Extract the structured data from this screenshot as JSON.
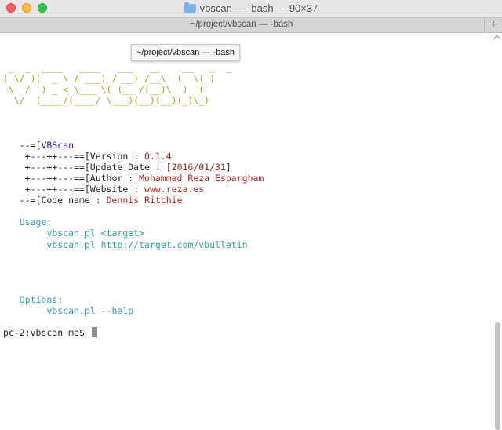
{
  "window": {
    "title": "vbscan — -bash — 90×37"
  },
  "tab": {
    "label": "~/project/vbscan — -bash",
    "add": "+"
  },
  "tooltip": "~/project/vbscan — -bash",
  "banner": [
    " _  _  ____   ____   ___   __    __   _  _ ",
    "( \\/ )(  _ \\ / ___) / __) /__\\  (  \\( )",
    " \\  /  ) _ < \\___ \\( (__ /(__)\\  )  (",
    "  \\/  (____/(____/ \\___)(__)(__)(_)\\_)"
  ],
  "info": {
    "vbscan_prefix": "   --=[",
    "vbscan_name": "VBScan",
    "version_prefix": "    +---++---==[Version : ",
    "version_value": "0.1.4",
    "update_prefix": "    +---++---==[Update Date : [",
    "update_value": "2016/01/31",
    "update_suffix": "]",
    "author_prefix": "    +---++---==[Author : ",
    "author_value": "Mohammad Reza Espargham",
    "website_prefix": "    +---++---==[Website : ",
    "website_value": "www.reza.es",
    "codename_prefix": "   --=[Code name : ",
    "codename_value": "Dennis Ritchie"
  },
  "usage": {
    "heading": "   Usage:",
    "line1": "        vbscan.pl <target>",
    "line2": "        vbscan.pl http://target.com/vbulletin"
  },
  "options": {
    "heading": "   Options:",
    "line1": "        vbscan.pl --help"
  },
  "prompt": "pc-2:vbscan me$ ",
  "colors": {
    "banner": "#b2a21a",
    "name": "#3c1ab2",
    "value": "#b5231d",
    "section": "#2e9fb2"
  }
}
